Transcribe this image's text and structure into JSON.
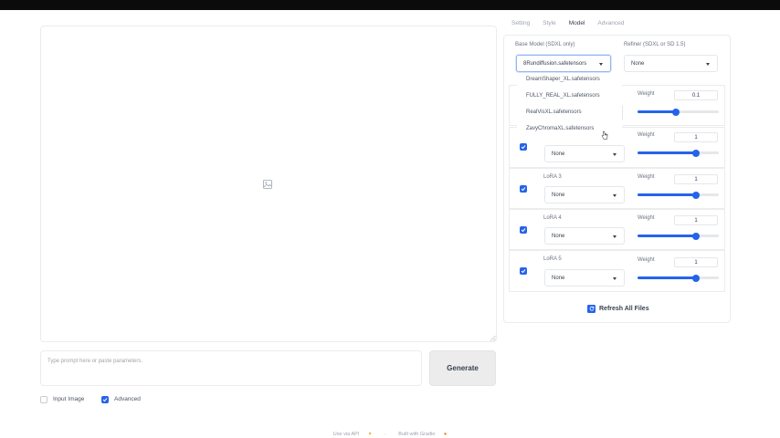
{
  "left": {
    "prompt_placeholder": "Type prompt here or paste parameters.",
    "generate_label": "Generate",
    "input_image_label": "Input Image",
    "input_image_checked": false,
    "advanced_label": "Advanced",
    "advanced_checked": true
  },
  "tabs": [
    {
      "label": "Setting",
      "active": false
    },
    {
      "label": "Style",
      "active": false
    },
    {
      "label": "Model",
      "active": true
    },
    {
      "label": "Advanced",
      "active": false
    }
  ],
  "model": {
    "base_label": "Base Model (SDXL only)",
    "base_value": "8Rundiffusion.safetensors",
    "refiner_label": "Refiner (SDXL or SD 1.5)",
    "refiner_value": "None",
    "dropdown_options": [
      "DreamShaper_XL.safetensors",
      "FULLY_REAL_XL.safetensors",
      "RealVisXL.safetensors",
      "ZavyChromaXL.safetensors"
    ]
  },
  "loras": [
    {
      "label": "",
      "value": "",
      "weight_label": "Weight",
      "weight": "0.1",
      "slider_fraction": 0.47,
      "checked": null
    },
    {
      "label": "",
      "value": "None",
      "weight_label": "Weight",
      "weight": "1",
      "slider_fraction": 0.72,
      "checked": true
    },
    {
      "label": "LoRA 3",
      "value": "None",
      "weight_label": "Weight",
      "weight": "1",
      "slider_fraction": 0.72,
      "checked": true
    },
    {
      "label": "LoRA 4",
      "value": "None",
      "weight_label": "Weight",
      "weight": "1",
      "slider_fraction": 0.72,
      "checked": true
    },
    {
      "label": "LoRA 5",
      "value": "None",
      "weight_label": "Weight",
      "weight": "1",
      "slider_fraction": 0.72,
      "checked": true
    }
  ],
  "refresh_label": "Refresh All Files",
  "footer": {
    "api": "Use via API",
    "built": "Built with Gradio"
  },
  "colors": {
    "accent": "#2563eb",
    "topbar": "#0b0b0b"
  }
}
